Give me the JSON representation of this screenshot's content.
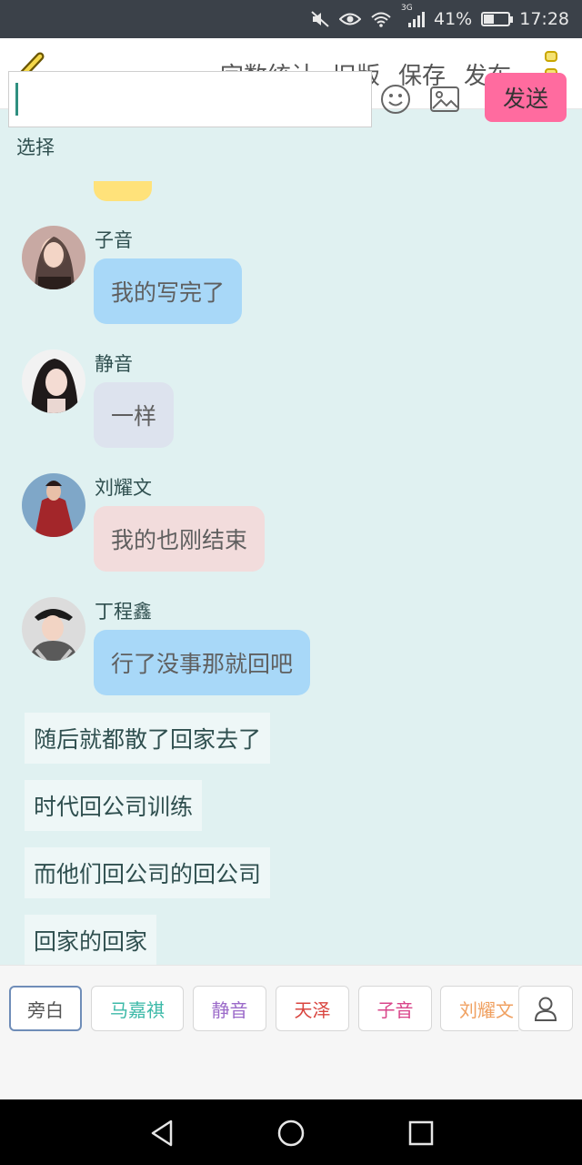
{
  "status": {
    "network": "3G",
    "battery_level": 41,
    "battery_text": "41%",
    "time": "17:28"
  },
  "header": {
    "actions": [
      "字数统计",
      "旧版",
      "保存",
      "发布"
    ]
  },
  "select_label": "选择",
  "messages": [
    {
      "sender": "子音",
      "text": "我的写完了",
      "bubble_color": "#a8d8f8"
    },
    {
      "sender": "静音",
      "text": "一样",
      "bubble_color": "#dde3ee"
    },
    {
      "sender": "刘耀文",
      "text": "我的也刚结束",
      "bubble_color": "#f2dcdc"
    },
    {
      "sender": "丁程鑫",
      "text": "行了没事那就回吧",
      "bubble_color": "#a8d8f8"
    }
  ],
  "narration": [
    "随后就都散了回家去了",
    "时代回公司训练",
    "而他们回公司的回公司",
    "回家的回家"
  ],
  "roles": [
    {
      "label": "旁白",
      "color": "#555555",
      "selected": true
    },
    {
      "label": "马嘉祺",
      "color": "#3cb9a8",
      "selected": false
    },
    {
      "label": "静音",
      "color": "#9b6ac9",
      "selected": false
    },
    {
      "label": "天泽",
      "color": "#d9453f",
      "selected": false
    },
    {
      "label": "子音",
      "color": "#d9458a",
      "selected": false
    },
    {
      "label": "刘耀文",
      "color": "#f0a060",
      "selected": false
    }
  ],
  "composer": {
    "input_value": "",
    "send_label": "发送"
  },
  "icons": {
    "back": "chevron-left-icon",
    "more": "more-vertical-icon",
    "emoji": "emoji-icon",
    "image": "image-icon",
    "person": "person-icon"
  },
  "colors": {
    "chat_background": "#e0f1f1",
    "send_button": "#ff6b9f",
    "accent_yellow": "#f5d84a"
  }
}
